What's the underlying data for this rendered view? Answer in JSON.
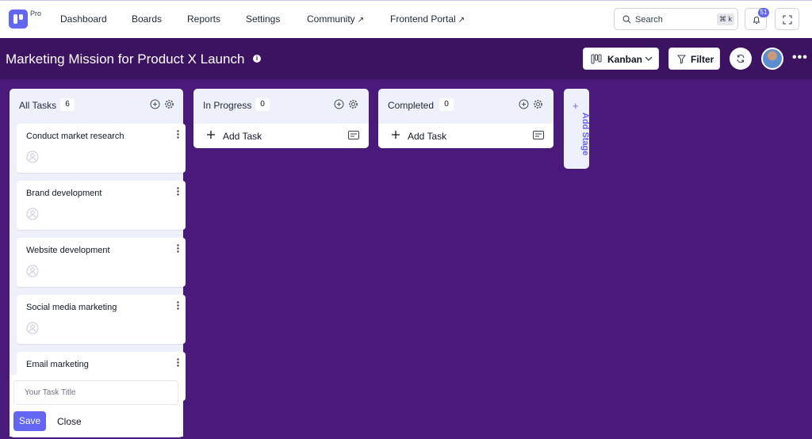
{
  "nav": {
    "logo_badge": "Pro",
    "links": [
      "Dashboard",
      "Boards",
      "Reports",
      "Settings",
      "Community",
      "Frontend Portal"
    ],
    "external_mark": "↗",
    "search": {
      "label": "Search",
      "shortcut": "⌘ k"
    },
    "notifications_count": "51"
  },
  "header": {
    "title": "Marketing Mission for Product X Launch",
    "view_label": "Kanban",
    "filter_label": "Filter"
  },
  "columns": [
    {
      "title": "All Tasks",
      "count": "6",
      "tasks": [
        "Conduct market research",
        "Brand development",
        "Website development",
        "Social media marketing",
        "Email marketing"
      ]
    },
    {
      "title": "In Progress",
      "count": "0",
      "add_task": "Add Task"
    },
    {
      "title": "Completed",
      "count": "0",
      "add_task": "Add Task"
    }
  ],
  "task_form": {
    "placeholder": "Your Task Title",
    "save": "Save",
    "close": "Close"
  },
  "add_stage": {
    "plus": "+",
    "label": "Add Stage"
  },
  "colors": {
    "accent": "#6366f1",
    "board_bg": "#4a1a7a",
    "header_bg": "#3b1360"
  }
}
